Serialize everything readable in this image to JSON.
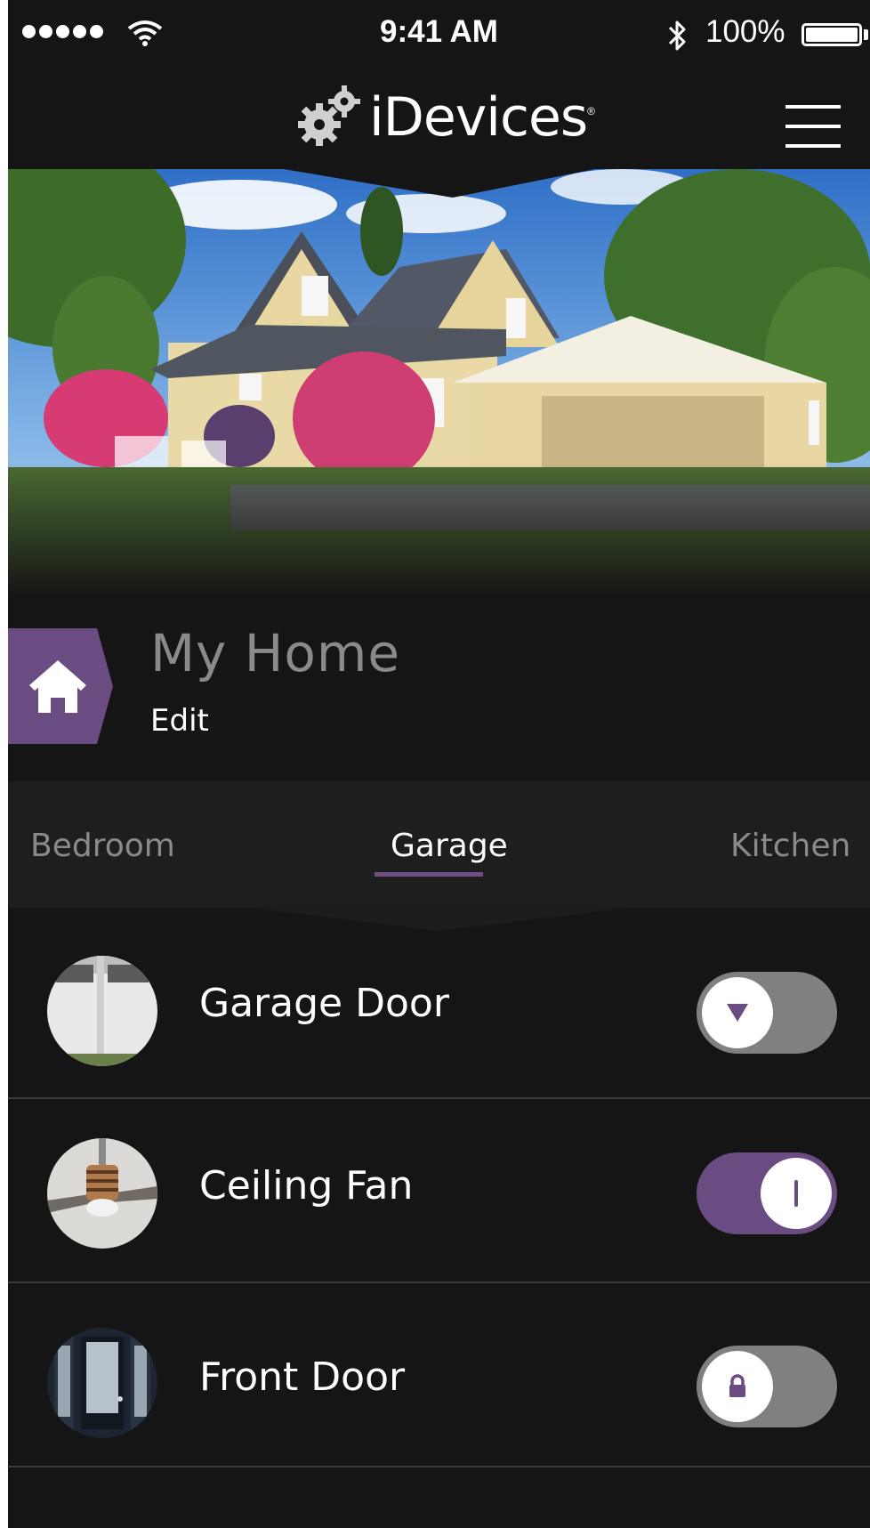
{
  "status_bar": {
    "time": "9:41 AM",
    "battery_percent": "100%",
    "signal_bars": 5
  },
  "header": {
    "logo_text": "iDevices",
    "logo_tm": "®",
    "menu_icon": "hamburger-icon"
  },
  "home": {
    "title": "My Home",
    "edit_label": "Edit",
    "icon": "house-icon"
  },
  "tabs": [
    {
      "label": "Bedroom",
      "active": false
    },
    {
      "label": "Garage",
      "active": true
    },
    {
      "label": "Kitchen",
      "active": false
    }
  ],
  "devices": [
    {
      "name": "Garage Door",
      "toggle_state": "off",
      "toggle_icon": "triangle-down-icon"
    },
    {
      "name": "Ceiling Fan",
      "toggle_state": "on",
      "toggle_icon": "power-line-icon"
    },
    {
      "name": "Front Door",
      "toggle_state": "off",
      "toggle_icon": "lock-icon"
    }
  ],
  "colors": {
    "accent": "#6a4c82",
    "background": "#151515",
    "tab_bar": "#1e1e1e",
    "toggle_off": "#808080"
  }
}
